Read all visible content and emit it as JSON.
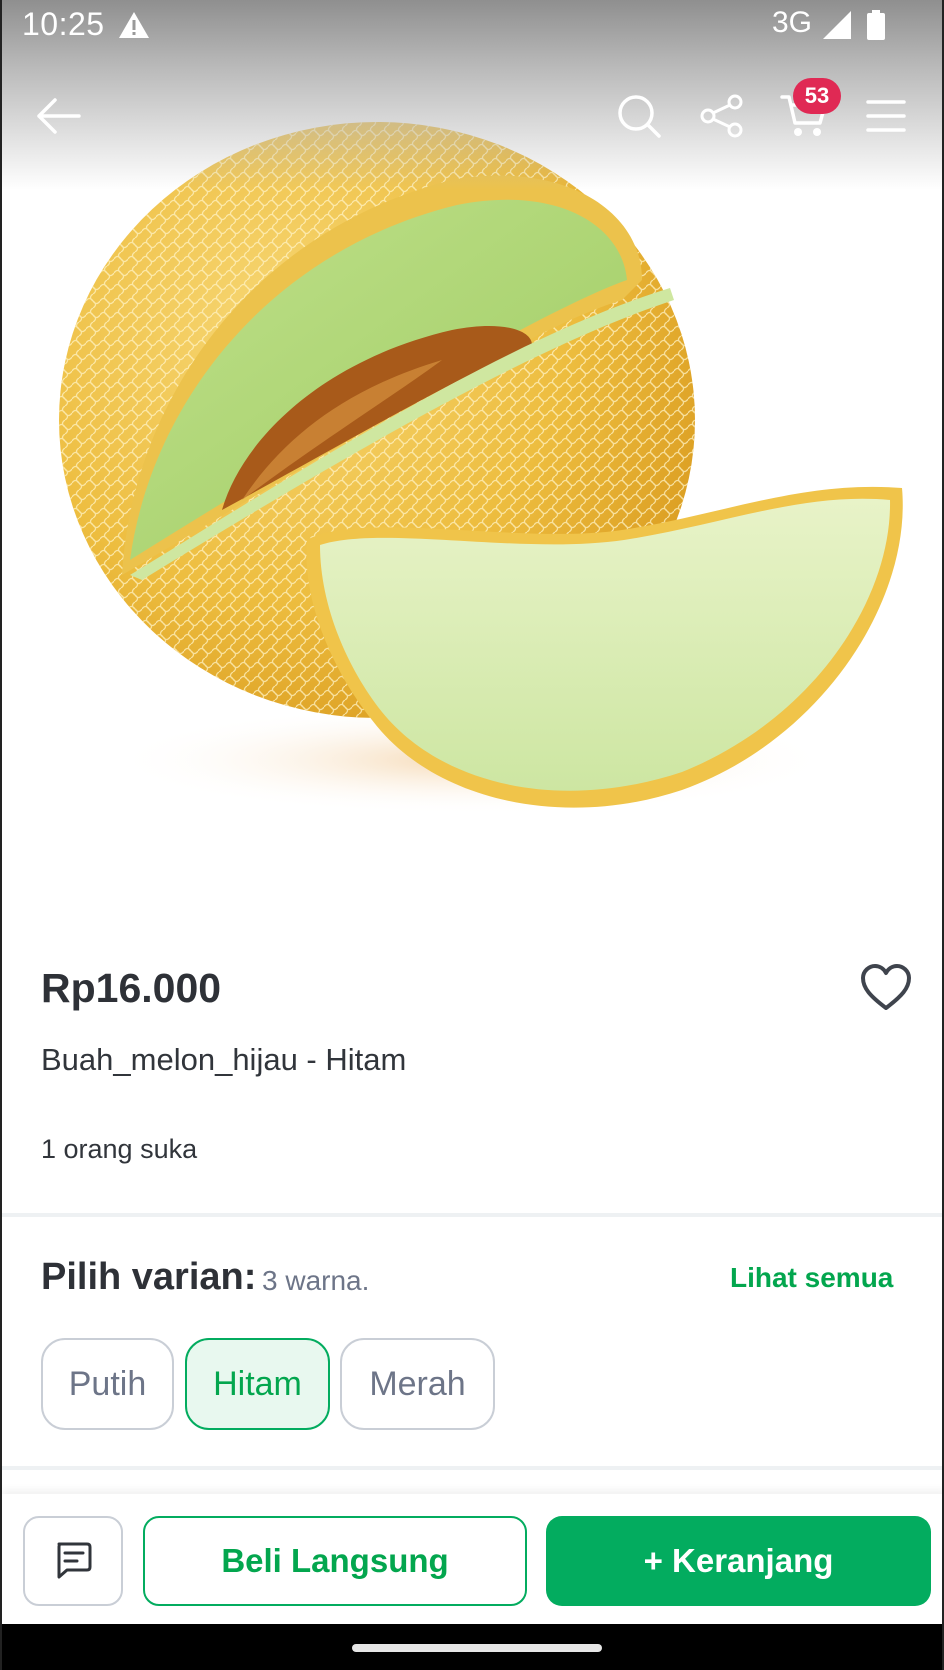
{
  "status_bar": {
    "time": "10:25",
    "network": "3G"
  },
  "app_bar": {
    "cart_badge_count": "53"
  },
  "product": {
    "price": "Rp16.000",
    "name": "Buah_melon_hijau - Hitam",
    "likes": "1 orang suka"
  },
  "variants": {
    "title": "Pilih varian:",
    "count_text": "3 warna.",
    "see_all": "Lihat semua",
    "options": [
      {
        "label": "Putih",
        "selected": false
      },
      {
        "label": "Hitam",
        "selected": true
      },
      {
        "label": "Merah",
        "selected": false
      }
    ]
  },
  "actions": {
    "buy_now": "Beli Langsung",
    "add_to_cart": "+ Keranjang"
  },
  "colors": {
    "accent_green": "#03AC5F",
    "badge_red": "#E02954",
    "selected_chip_bg": "#E8F8EF"
  }
}
